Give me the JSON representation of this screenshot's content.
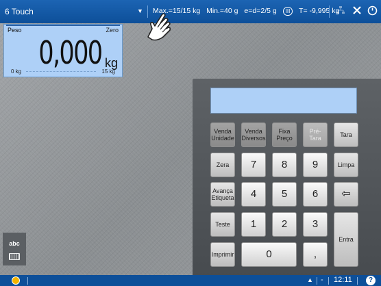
{
  "topbar": {
    "app_title": "6 Touch",
    "dropdown_glyph": "▼",
    "max": "Max.=15/15 kg",
    "min": "Min.=40 g",
    "e_d": "e=d=2/5 g",
    "class": "III",
    "tare": "T= -9,995 kg",
    "icons": [
      "network-icon",
      "close-icon",
      "power-icon"
    ]
  },
  "weight_panel": {
    "label": "Peso",
    "zero": "Zero",
    "value": "0,000",
    "unit": "kg",
    "range_min": "0 kg",
    "range_max": "15 kg"
  },
  "keypad": {
    "display_value": "",
    "keys": {
      "venda_unidade": "Venda Unidade",
      "venda_diversos": "Venda Diversos",
      "fixa_preco": "Fixa Preço",
      "pre_tara": "Pré-Tara",
      "tara": "Tara",
      "zera": "Zera",
      "limpa": "Limpa",
      "avanca_etiqueta": "Avança Etiqueta",
      "teste": "Teste",
      "imprimir": "Imprimir",
      "entra": "Entra",
      "comma": ",",
      "backspace": "⇦",
      "n0": "0",
      "n1": "1",
      "n2": "2",
      "n3": "3",
      "n4": "4",
      "n5": "5",
      "n6": "6",
      "n7": "7",
      "n8": "8",
      "n9": "9"
    }
  },
  "side_widget": {
    "label": "abc"
  },
  "bottombar": {
    "status_color": "#f4b400",
    "up_arrow": "▲",
    "dash": "-",
    "time": "12:11",
    "help": "?"
  },
  "colors": {
    "accent": "#0d4f99",
    "display": "#aed0f7"
  }
}
